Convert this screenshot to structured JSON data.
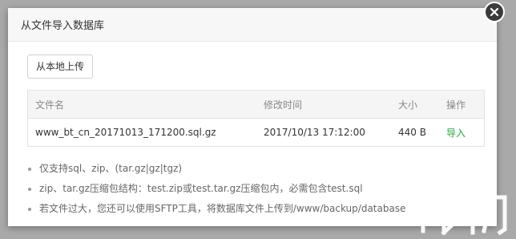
{
  "dialog": {
    "title": "从文件导入数据库",
    "upload_label": "从本地上传"
  },
  "table": {
    "headers": {
      "name": "文件名",
      "mtime": "修改时间",
      "size": "大小",
      "action": "操作"
    },
    "rows": [
      {
        "name": "www_bt_cn_20171013_171200.sql.gz",
        "mtime": "2017/10/13 17:12:00",
        "size": "440 B",
        "action": "导入"
      }
    ]
  },
  "notes": [
    "仅支持sql、zip、(tar.gz|gz|tgz)",
    "zip、tar.gz压缩包结构：test.zip或test.tar.gz压缩包内，必需包含test.sql",
    "若文件过大，您还可以使用SFTP工具，将数据库文件上传到/www/backup/database"
  ],
  "colors": {
    "accent_green": "#20a53a",
    "overlay": "#a9a9a9"
  },
  "icons": {
    "close": "close-icon"
  }
}
